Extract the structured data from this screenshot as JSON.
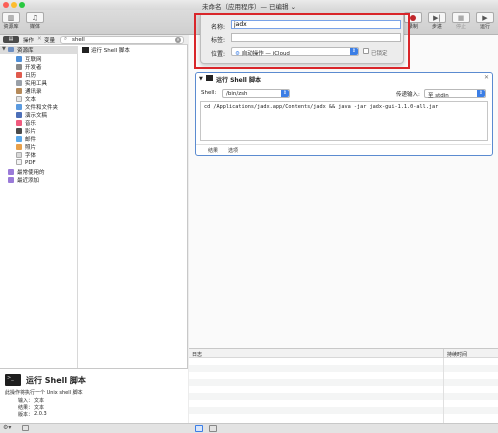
{
  "window": {
    "title": "未命名（应用程序）— 已编辑 ⌄"
  },
  "toolbar": {
    "library_label": "资源库",
    "media_label": "媒体",
    "record_label": "录制",
    "step_label": "步进",
    "stop_label": "停止",
    "run_label": "运行"
  },
  "sidebar": {
    "seg_actions": "操作",
    "seg_variables": "变量",
    "search_value": "shell",
    "library_root": "资源库",
    "categories": [
      "互联网",
      "开发者",
      "日历",
      "实用工具",
      "通讯录",
      "文本",
      "文件和文件夹",
      "演示文稿",
      "音乐",
      "影片",
      "邮件",
      "照片",
      "字体",
      "PDF"
    ],
    "recent_used": "最常使用的",
    "recent_added": "最近添加",
    "result_item": "运行 Shell 脚本"
  },
  "description": {
    "title": "运行 Shell 脚本",
    "text": "此操作将执行一个 Unix shell 脚本",
    "input_label": "输入：",
    "input_value": "文本",
    "result_label": "结果：",
    "result_value": "文本",
    "version_label": "版本：",
    "version_value": "2.0.3"
  },
  "save_sheet": {
    "name_label": "名称:",
    "name_value": "jadx",
    "tags_label": "标签:",
    "tags_value": "",
    "location_label": "位置:",
    "location_value": "自动操作 — iCloud",
    "locked_label": "已锁定"
  },
  "action": {
    "title": "运行 Shell 脚本",
    "shell_label": "Shell:",
    "shell_value": "/bin/zsh",
    "pass_label": "传递输入:",
    "pass_value": "至 stdin",
    "script": "cd /Applications/jadx.app/Contents/jadx && java -jar jadx-gui-1.1.0-all.jar",
    "tab_results": "结果",
    "tab_options": "选项"
  },
  "log": {
    "col_log": "日志",
    "col_duration": "持续时间"
  },
  "colors": {
    "accent": "#3b7ee6",
    "highlight_border": "#d9262a",
    "record_red": "#c0262a"
  }
}
